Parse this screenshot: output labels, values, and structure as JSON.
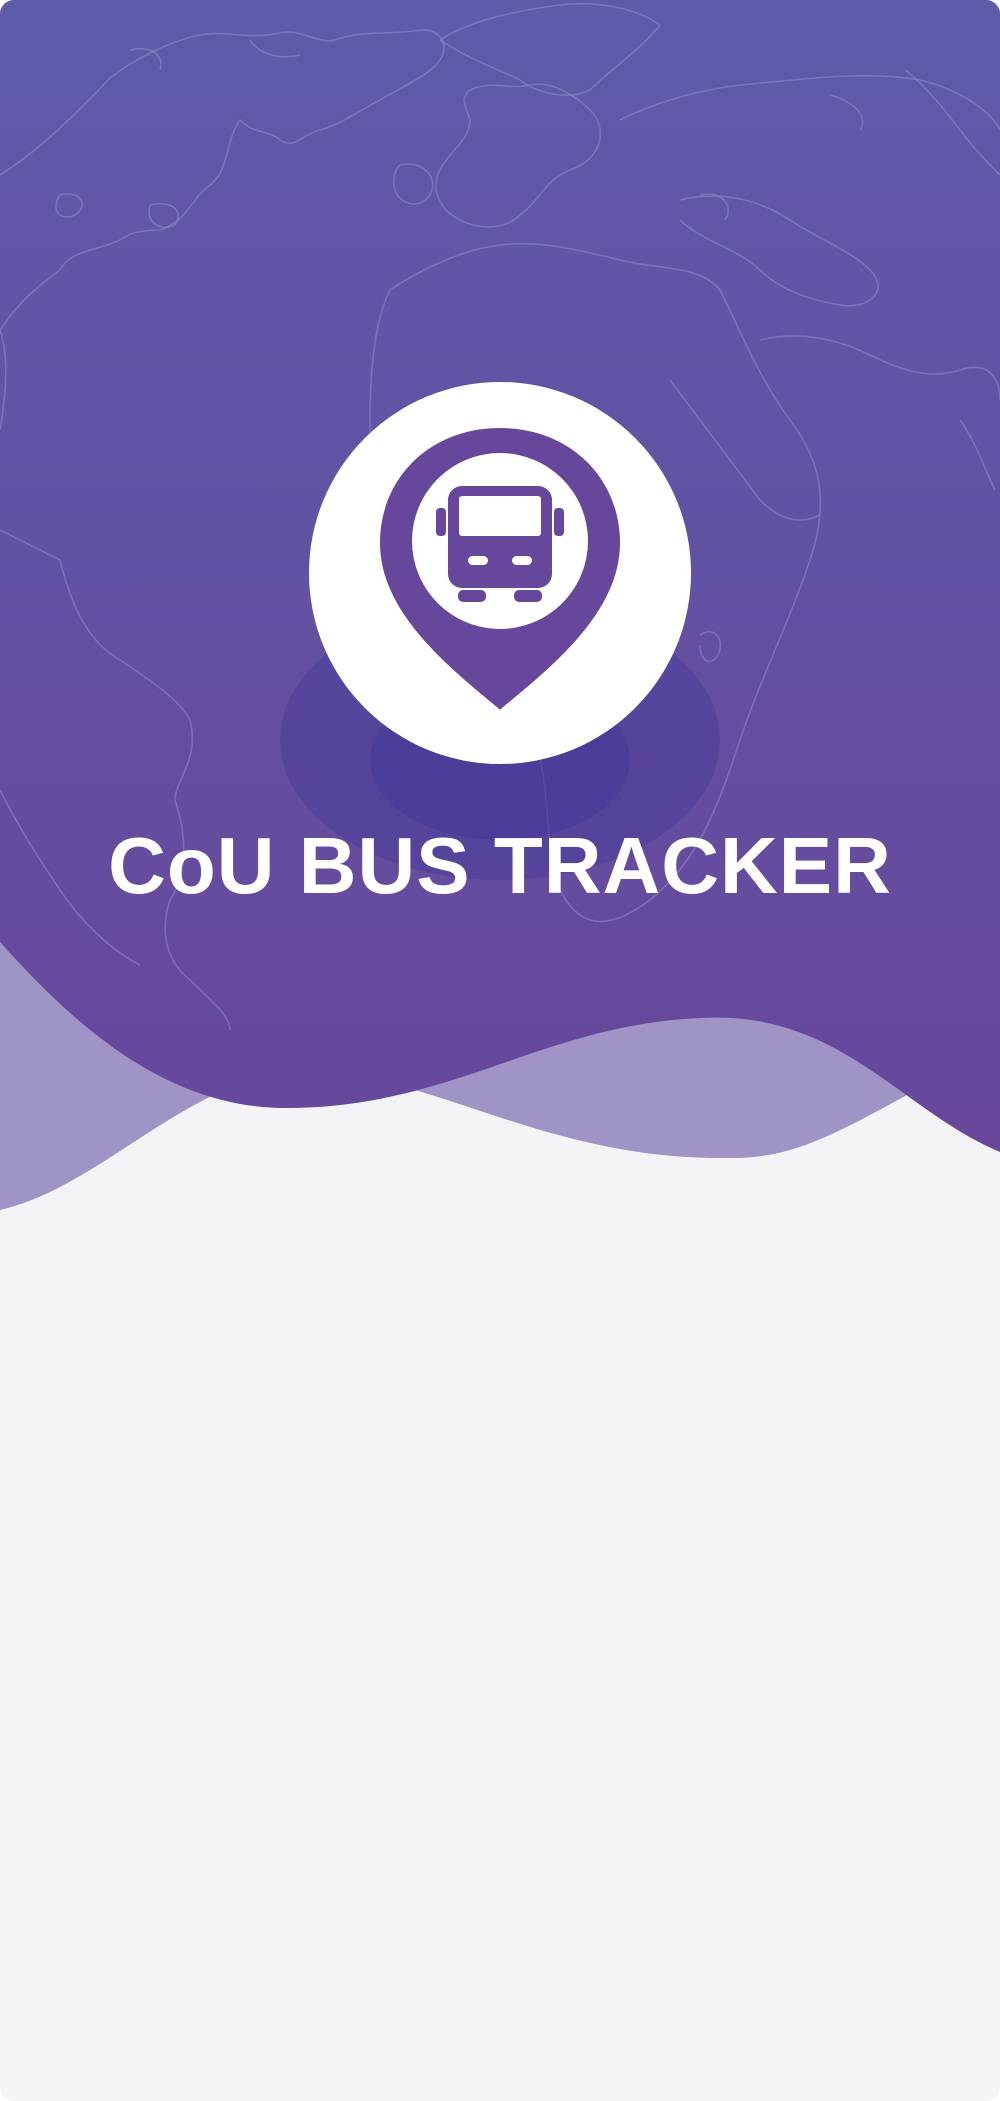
{
  "app": {
    "title": "CoU BUS TRACKER"
  },
  "logo": {
    "icon": "map-pin-bus-icon"
  },
  "colors": {
    "header_top": "#5e5ba9",
    "header_bottom": "#67479b",
    "wave_back": "#a093c6",
    "content_background": "#f4f4f7",
    "logo_background": "#ffffff",
    "pin": "#67479b",
    "title_text": "#ffffff"
  }
}
